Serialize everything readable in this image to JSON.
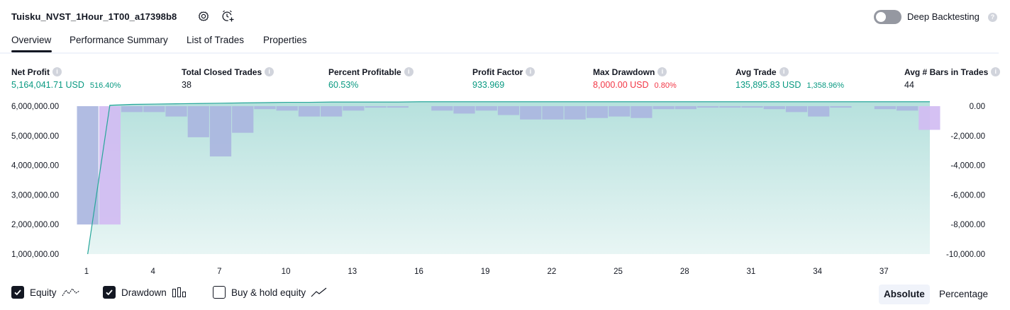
{
  "header": {
    "strategy_title": "Tuisku_NVST_1Hour_1T00_a17398b8",
    "settings_icon": "gear-icon",
    "alert_icon": "alarm-clock-plus-icon",
    "deep_backtesting_label": "Deep Backtesting",
    "deep_backtesting_enabled": false
  },
  "tabs": [
    {
      "label": "Overview",
      "active": true
    },
    {
      "label": "Performance Summary",
      "active": false
    },
    {
      "label": "List of Trades",
      "active": false
    },
    {
      "label": "Properties",
      "active": false
    }
  ],
  "stats": [
    {
      "label": "Net Profit",
      "value": "5,164,041.71 USD",
      "sub": "516.40%",
      "tone": "pos"
    },
    {
      "label": "Total Closed Trades",
      "value": "38",
      "sub": "",
      "tone": "neu"
    },
    {
      "label": "Percent Profitable",
      "value": "60.53%",
      "sub": "",
      "tone": "pos"
    },
    {
      "label": "Profit Factor",
      "value": "933.969",
      "sub": "",
      "tone": "pos"
    },
    {
      "label": "Max Drawdown",
      "value": "8,000.00 USD",
      "sub": "0.80%",
      "tone": "neg"
    },
    {
      "label": "Avg Trade",
      "value": "135,895.83 USD",
      "sub": "1,358.96%",
      "tone": "pos"
    },
    {
      "label": "Avg # Bars in Trades",
      "value": "44",
      "sub": "",
      "tone": "neu"
    }
  ],
  "colors": {
    "positive": "#089981",
    "negative": "#f23645",
    "equity_line": "#26a69a",
    "equity_fill": "#b2dfdb",
    "drawdown_bar": "#aab6e0",
    "drawdown_max_bar": "#d1bcf2",
    "accent": "#131722"
  },
  "chart_data": {
    "type": "line",
    "trades": [
      1,
      2,
      3,
      4,
      5,
      6,
      7,
      8,
      9,
      10,
      11,
      12,
      13,
      14,
      15,
      16,
      17,
      18,
      19,
      20,
      21,
      22,
      23,
      24,
      25,
      26,
      27,
      28,
      29,
      30,
      31,
      32,
      33,
      34,
      35,
      36,
      37,
      38,
      39
    ],
    "x_tick_labels": [
      "1",
      "4",
      "7",
      "10",
      "13",
      "16",
      "19",
      "22",
      "25",
      "28",
      "31",
      "34",
      "37"
    ],
    "left_axis": {
      "tick_labels": [
        "6,000,000.00",
        "5,000,000.00",
        "4,000,000.00",
        "3,000,000.00",
        "2,000,000.00",
        "1,000,000.00"
      ],
      "ylim": [
        1000000,
        6000000
      ]
    },
    "right_axis": {
      "tick_labels": [
        "0.00",
        "-2,000.00",
        "-4,000.00",
        "-6,000.00",
        "-8,000.00",
        "-10,000.00"
      ],
      "ylim": [
        -10000,
        0
      ]
    },
    "series": [
      {
        "name": "Equity",
        "axis": "left",
        "values": [
          1000000,
          6030000,
          6060000,
          6070000,
          6080000,
          6090000,
          6100000,
          6110000,
          6120000,
          6130000,
          6130000,
          6140000,
          6140000,
          6140000,
          6140000,
          6150000,
          6150000,
          6150000,
          6150000,
          6150000,
          6150000,
          6150000,
          6150000,
          6150000,
          6150000,
          6150000,
          6150000,
          6150000,
          6150000,
          6150000,
          6150000,
          6150000,
          6150000,
          6150000,
          6150000,
          6150000,
          6150000,
          6150000,
          6150000
        ]
      },
      {
        "name": "Drawdown",
        "axis": "right",
        "values": [
          -8000,
          -8000,
          -400,
          -400,
          -700,
          -2100,
          -3400,
          -1800,
          -200,
          -300,
          -700,
          -700,
          -300,
          -100,
          -100,
          0,
          -300,
          -500,
          -300,
          -600,
          -900,
          -900,
          -900,
          -800,
          -700,
          -800,
          -200,
          -200,
          -100,
          -100,
          -100,
          -200,
          -400,
          -700,
          -100,
          0,
          -200,
          -300,
          -1600
        ],
        "max_drawdown_indices": [
          1,
          38
        ]
      }
    ]
  },
  "legend": {
    "equity": {
      "label": "Equity",
      "checked": true,
      "icon": "equity-line-icon"
    },
    "drawdown": {
      "label": "Drawdown",
      "checked": true,
      "icon": "drawdown-bars-icon"
    },
    "buy_hold": {
      "label": "Buy & hold equity",
      "checked": false,
      "icon": "buy-hold-line-icon"
    }
  },
  "view_modes": {
    "absolute_label": "Absolute",
    "percentage_label": "Percentage",
    "active": "absolute"
  }
}
